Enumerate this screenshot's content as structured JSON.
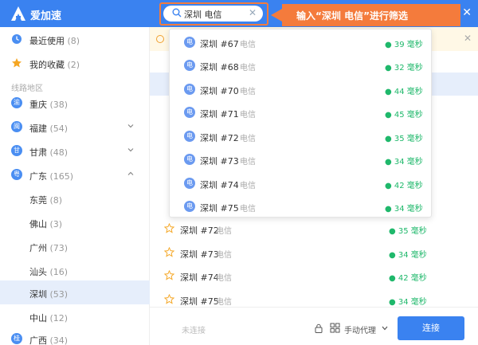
{
  "app": {
    "name": "爱加速"
  },
  "search": {
    "value": "深圳 电信"
  },
  "callout": {
    "text": "输入“深圳 电信”进行筛选"
  },
  "sidebar": {
    "top_items": [
      {
        "label": "最近使用",
        "count": "(8)"
      },
      {
        "label": "我的收藏",
        "count": "(2)"
      }
    ],
    "section_heading": "线路地区",
    "regions": [
      {
        "icon": "渝",
        "label": "重庆",
        "count": "(38)"
      },
      {
        "icon": "闽",
        "label": "福建",
        "count": "(54)"
      },
      {
        "icon": "甘",
        "label": "甘肃",
        "count": "(48)"
      },
      {
        "icon": "粤",
        "label": "广东",
        "count": "(165)"
      },
      {
        "label": "东莞",
        "count": "(8)"
      },
      {
        "label": "佛山",
        "count": "(3)"
      },
      {
        "label": "广州",
        "count": "(73)"
      },
      {
        "label": "汕头",
        "count": "(16)"
      },
      {
        "label": "深圳",
        "count": "(53)"
      },
      {
        "label": "中山",
        "count": "(12)"
      },
      {
        "icon": "桂",
        "label": "广西",
        "count": "(34)"
      }
    ]
  },
  "dropdown": {
    "icon": "电",
    "items": [
      {
        "name": "深圳 #67",
        "isp": "电信",
        "ping": "● 39 毫秒"
      },
      {
        "name": "深圳 #68",
        "isp": "电信",
        "ping": "● 32 毫秒"
      },
      {
        "name": "深圳 #70",
        "isp": "电信",
        "ping": "● 44 毫秒"
      },
      {
        "name": "深圳 #71",
        "isp": "电信",
        "ping": "● 45 毫秒"
      },
      {
        "name": "深圳 #72",
        "isp": "电信",
        "ping": "● 35 毫秒"
      },
      {
        "name": "深圳 #73",
        "isp": "电信",
        "ping": "● 34 毫秒"
      },
      {
        "name": "深圳 #74",
        "isp": "电信",
        "ping": "● 42 毫秒"
      },
      {
        "name": "深圳 #75",
        "isp": "电信",
        "ping": "● 34 毫秒"
      }
    ]
  },
  "main_rows": [
    {
      "name": "深圳 #72",
      "isp": "电信",
      "ping": "● 35 毫秒"
    },
    {
      "name": "深圳 #73",
      "isp": "电信",
      "ping": "● 34 毫秒"
    },
    {
      "name": "深圳 #74",
      "isp": "电信",
      "ping": "● 42 毫秒"
    },
    {
      "name": "深圳 #75",
      "isp": "电信",
      "ping": "● 34 毫秒"
    }
  ],
  "footer": {
    "status": "未连接",
    "proxy_mode": "手动代理",
    "connect_label": "连接"
  },
  "colors": {
    "brand_blue": "#3a82f0",
    "callout_orange": "#f47b3c",
    "ping_green": "#1fb86b"
  }
}
